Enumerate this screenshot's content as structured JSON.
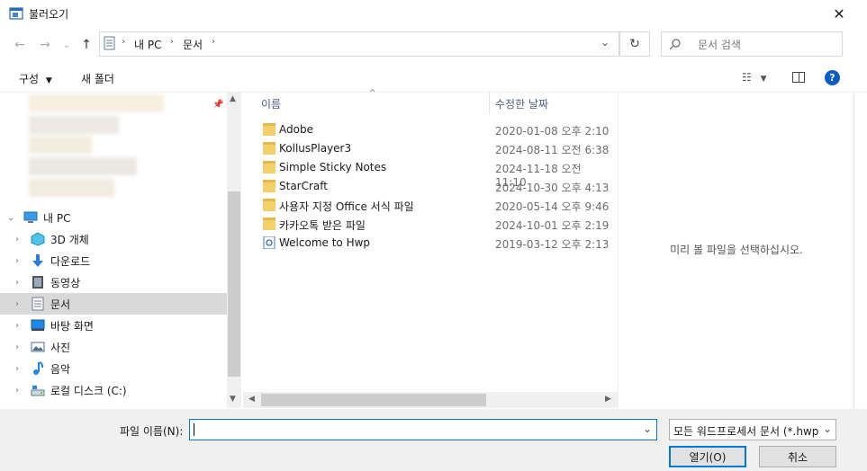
{
  "window": {
    "title": "불러오기"
  },
  "nav": {
    "path": [
      "내 PC",
      "문서"
    ],
    "search_placeholder": "문서 검색"
  },
  "toolbar": {
    "organize": "구성",
    "new_folder": "새 폴더"
  },
  "sidebar": {
    "items": [
      {
        "label": "내 PC",
        "icon": "pc-icon",
        "level": 0,
        "expanded": true
      },
      {
        "label": "3D 개체",
        "icon": "3d-objects-icon",
        "level": 1
      },
      {
        "label": "다운로드",
        "icon": "download-icon",
        "level": 1
      },
      {
        "label": "동영상",
        "icon": "video-icon",
        "level": 1
      },
      {
        "label": "문서",
        "icon": "document-icon",
        "level": 1,
        "selected": true
      },
      {
        "label": "바탕 화면",
        "icon": "desktop-icon",
        "level": 1
      },
      {
        "label": "사진",
        "icon": "pictures-icon",
        "level": 1
      },
      {
        "label": "음악",
        "icon": "music-icon",
        "level": 1
      },
      {
        "label": "로컬 디스크 (C:)",
        "icon": "drive-icon",
        "level": 1
      }
    ]
  },
  "list": {
    "col_name": "이름",
    "col_date": "수정한 날짜",
    "files": [
      {
        "name": "Adobe",
        "date": "2020-01-08 오후 2:10",
        "type": "folder"
      },
      {
        "name": "KollusPlayer3",
        "date": "2024-08-11 오전 6:38",
        "type": "folder"
      },
      {
        "name": "Simple Sticky Notes",
        "date": "2024-11-18 오전 11:10",
        "type": "folder"
      },
      {
        "name": "StarCraft",
        "date": "2024-10-30 오후 4:13",
        "type": "folder"
      },
      {
        "name": "사용자 지정 Office 서식 파일",
        "date": "2020-05-14 오후 9:46",
        "type": "folder"
      },
      {
        "name": "카카오톡 받은 파일",
        "date": "2024-10-01 오후 2:19",
        "type": "folder"
      },
      {
        "name": "Welcome to Hwp",
        "date": "2019-03-12 오후 2:13",
        "type": "hwp"
      }
    ]
  },
  "preview": {
    "message": "미리 볼 파일을 선택하십시오."
  },
  "bottom": {
    "filename_label": "파일 이름(N):",
    "filename_value": "",
    "filetype": "모든 워드프로세서 문서 (*.hwp",
    "open": "열기(O)",
    "cancel": "취소"
  },
  "colors": {
    "accent": "#0078d7",
    "selected": "#d9d9d9",
    "header_text": "#4d6082"
  }
}
